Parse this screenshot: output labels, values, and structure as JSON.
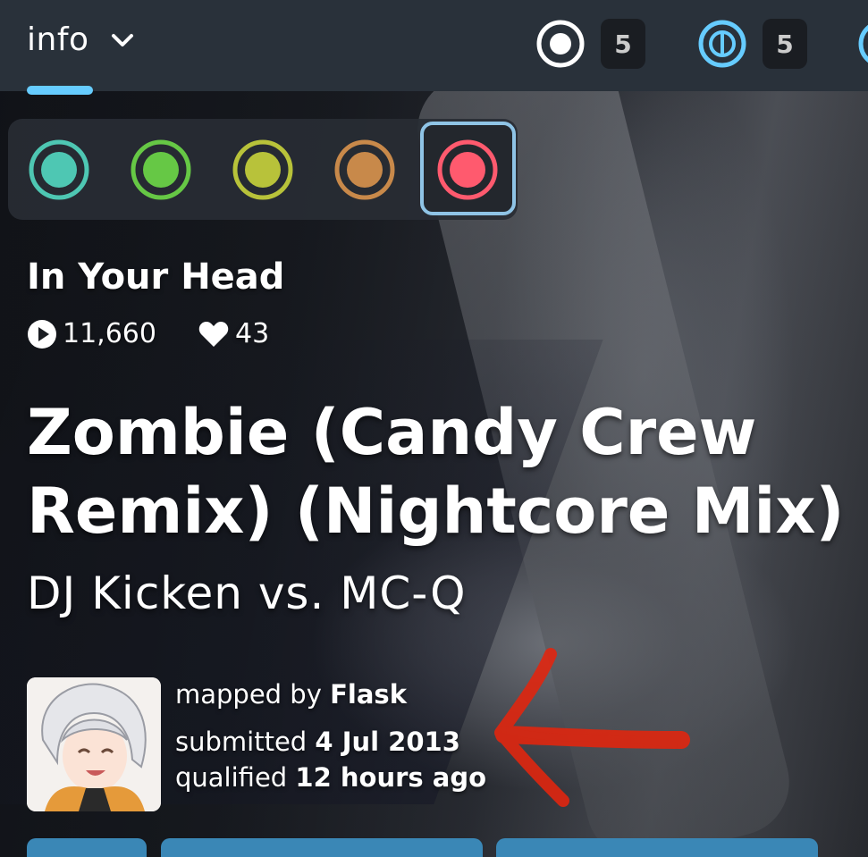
{
  "header": {
    "tab_label": "info",
    "modes": [
      {
        "icon": "osu-standard-icon",
        "count": "5",
        "color": "#ffffff"
      },
      {
        "icon": "osu-taiko-icon",
        "count": "5",
        "color": "#66ccff"
      },
      {
        "icon": "osu-catch-icon",
        "count": "",
        "color": "#66ccff"
      }
    ],
    "accent_color": "#66ccff"
  },
  "difficulties": [
    {
      "icon": "difficulty-icon",
      "color": "#4ec7b3",
      "selected": false
    },
    {
      "icon": "difficulty-icon",
      "color": "#66c845",
      "selected": false
    },
    {
      "icon": "difficulty-icon",
      "color": "#b8c23a",
      "selected": false
    },
    {
      "icon": "difficulty-icon",
      "color": "#c8894a",
      "selected": false
    },
    {
      "icon": "difficulty-icon",
      "color": "#ff5a6e",
      "selected": true
    }
  ],
  "beatmap": {
    "difficulty_name": "In Your Head",
    "play_count": "11,660",
    "favourite_count": "43",
    "title": "Zombie (Candy Crew Remix) (Nightcore Mix)",
    "artist": "DJ Kicken vs. MC-Q"
  },
  "mapper": {
    "mapped_by_label": "mapped by",
    "name": "Flask",
    "submitted_label": "submitted",
    "submitted_date": "4 Jul 2013",
    "qualified_label": "qualified",
    "qualified_date": "12 hours ago"
  }
}
